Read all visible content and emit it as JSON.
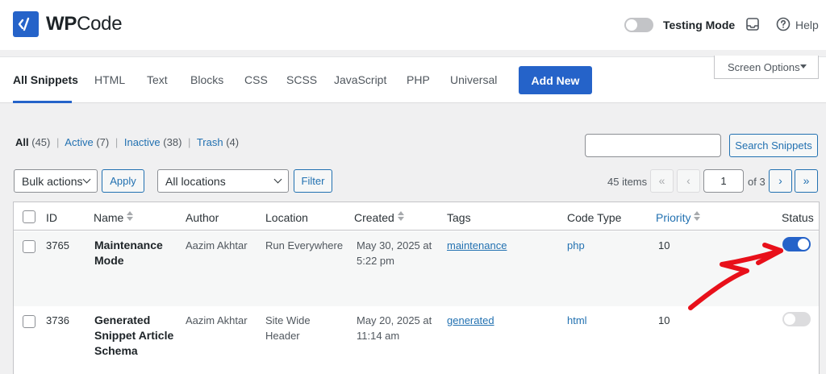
{
  "header": {
    "logo_bold": "WP",
    "logo_rest": "Code",
    "testing_mode_label": "Testing Mode",
    "testing_mode_on": false,
    "help_label": "Help"
  },
  "tabs": [
    {
      "label": "All Snippets",
      "active": true
    },
    {
      "label": "HTML"
    },
    {
      "label": "Text"
    },
    {
      "label": "Blocks"
    },
    {
      "label": "CSS"
    },
    {
      "label": "SCSS"
    },
    {
      "label": "JavaScript"
    },
    {
      "label": "PHP"
    },
    {
      "label": "Universal"
    }
  ],
  "add_new_label": "Add New",
  "screen_options_label": "Screen Options",
  "views": {
    "all": {
      "label": "All",
      "count": "(45)"
    },
    "active": {
      "label": "Active",
      "count": "(7)"
    },
    "inactive": {
      "label": "Inactive",
      "count": "(38)"
    },
    "trash": {
      "label": "Trash",
      "count": "(4)"
    }
  },
  "search": {
    "value": "",
    "button_label": "Search Snippets"
  },
  "bulk_actions": {
    "selected": "Bulk actions",
    "apply_label": "Apply"
  },
  "locations": {
    "selected": "All locations",
    "filter_label": "Filter"
  },
  "pagination": {
    "items_text": "45 items",
    "first": "«",
    "prev": "‹",
    "current_page": "1",
    "of_text": "of 3",
    "next": "›",
    "last": "»"
  },
  "columns": {
    "id": "ID",
    "name": "Name",
    "author": "Author",
    "location": "Location",
    "created": "Created",
    "tags": "Tags",
    "code_type": "Code Type",
    "priority": "Priority",
    "status": "Status"
  },
  "rows": [
    {
      "id": "3765",
      "name_lines": [
        "Maintenance",
        "Mode"
      ],
      "author": "Aazim Akhtar",
      "location_lines": [
        "Run Everywhere",
        ""
      ],
      "created_lines": [
        "May 30, 2025 at",
        "5:22 pm"
      ],
      "tag": "maintenance",
      "code_type": "php",
      "priority": "10",
      "active": true
    },
    {
      "id": "3736",
      "name_lines": [
        "Generated",
        "Snippet Article",
        "Schema"
      ],
      "author": "Aazim Akhtar",
      "location_lines": [
        "Site Wide",
        "Header"
      ],
      "created_lines": [
        "May 20, 2025 at",
        "11:14 am"
      ],
      "tag": "generated",
      "code_type": "html",
      "priority": "10",
      "active": false
    }
  ],
  "colors": {
    "brand": "#2563c9",
    "link": "#2271b1",
    "annotation_arrow": "#e8101a"
  }
}
